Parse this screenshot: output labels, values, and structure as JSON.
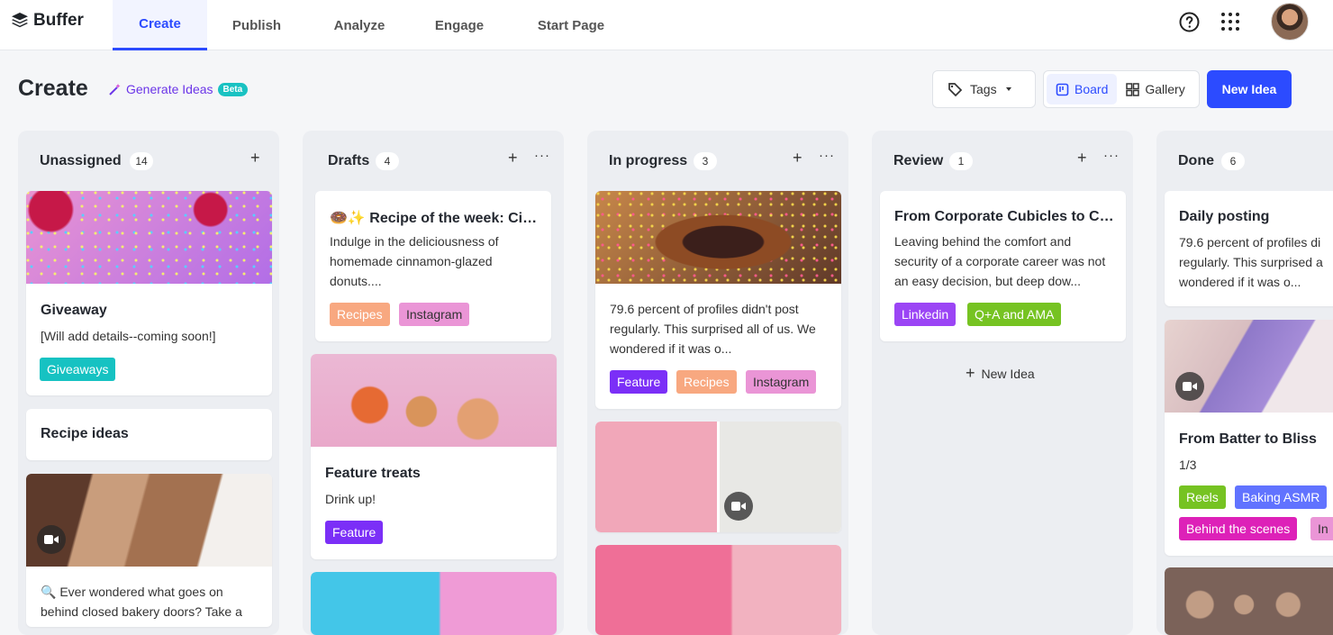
{
  "brand": {
    "logo": "Buffer"
  },
  "nav": {
    "tabs": [
      {
        "label": "Create"
      },
      {
        "label": "Publish"
      },
      {
        "label": "Analyze"
      },
      {
        "label": "Engage"
      },
      {
        "label": "Start Page"
      }
    ]
  },
  "header": {
    "title": "Create",
    "generate": "Generate Ideas",
    "beta": "Beta",
    "tags": "Tags",
    "board": "Board",
    "gallery": "Gallery",
    "new_idea": "New Idea"
  },
  "columns": [
    {
      "name": "Unassigned",
      "count": "14"
    },
    {
      "name": "Drafts",
      "count": "4"
    },
    {
      "name": "In progress",
      "count": "3"
    },
    {
      "name": "Review",
      "count": "1"
    },
    {
      "name": "Done",
      "count": "6"
    }
  ],
  "cards": {
    "giveaway": {
      "title": "Giveaway",
      "body": "[Will add details--coming soon!]",
      "tags": [
        "Giveaways"
      ]
    },
    "recipe_ideas": {
      "title": "Recipe ideas"
    },
    "bakery": {
      "body": "🔍 Ever wondered what goes on behind closed bakery doors? Take a"
    },
    "recipe_week": {
      "title": "🍩✨ Recipe of the week: Cin...",
      "body": "Indulge in the deliciousness of homemade cinnamon-glazed donuts....",
      "tags": [
        "Recipes",
        "Instagram"
      ]
    },
    "feature_treats": {
      "title": "Feature treats",
      "body": "Drink up!",
      "tags": [
        "Feature"
      ]
    },
    "progress": {
      "body": "79.6 percent of profiles didn't post regularly. This surprised all of us. We wondered if it was o...",
      "tags": [
        "Feature",
        "Recipes",
        "Instagram"
      ]
    },
    "corporate": {
      "title": "From Corporate Cubicles to Co...",
      "body": "Leaving behind the comfort and security of a corporate career was not an easy decision, but deep dow...",
      "tags": [
        "Linkedin",
        "Q+A and AMA"
      ]
    },
    "review_new": "New Idea",
    "daily": {
      "title": "Daily posting",
      "body": "79.6 percent of profiles di regularly. This surprised a wondered if it was o..."
    },
    "batter": {
      "title": "From Batter to Bliss",
      "body": "1/3",
      "tags": [
        "Reels",
        "Baking ASMR",
        "Behind the scenes",
        "In"
      ]
    }
  },
  "colors": {
    "accent": "#2c4bff",
    "purple": "#7b2ff7",
    "teal": "#16c2c2",
    "peach": "#f8a880",
    "pink": "#ea95d6",
    "green": "#76c322",
    "magenta": "#dd21b8",
    "blue": "#6173ff"
  }
}
